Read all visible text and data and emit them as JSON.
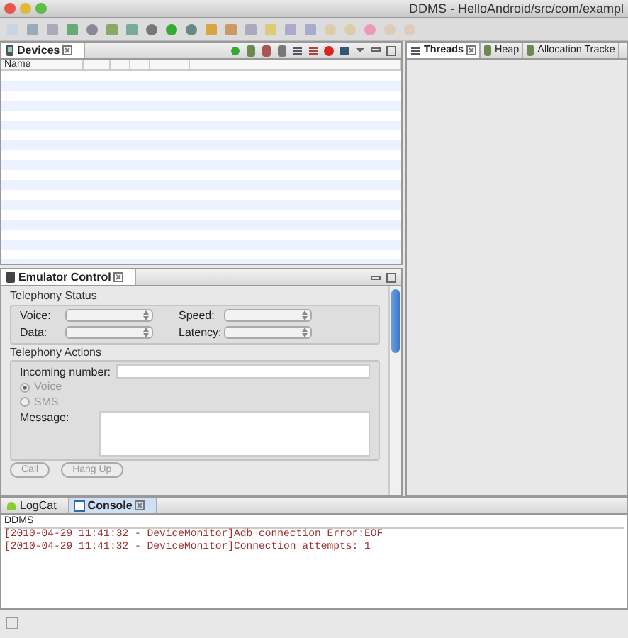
{
  "window": {
    "title": "DDMS - HelloAndroid/src/com/exampl"
  },
  "devices_view": {
    "tab": {
      "label": "Devices",
      "selected": true
    },
    "table": {
      "columns": [
        "Name"
      ]
    }
  },
  "right_tabs": [
    {
      "label": "Threads",
      "selected": true,
      "kind": "threads"
    },
    {
      "label": "Heap",
      "selected": false,
      "kind": "heap"
    },
    {
      "label": "Allocation Tracke",
      "selected": false,
      "kind": "heap"
    }
  ],
  "emulator_control": {
    "tab": {
      "label": "Emulator Control",
      "selected": true
    },
    "telephony_status": {
      "title": "Telephony Status",
      "fields": [
        {
          "label": "Voice:"
        },
        {
          "label": "Speed:"
        },
        {
          "label": "Data:"
        },
        {
          "label": "Latency:"
        }
      ]
    },
    "telephony_actions": {
      "title": "Telephony Actions",
      "incoming_number": {
        "label": "Incoming number:"
      },
      "options": [
        {
          "label": "Voice",
          "selected": true,
          "disabled": true
        },
        {
          "label": "SMS",
          "selected": false,
          "disabled": true
        }
      ],
      "message": {
        "label": "Message:"
      },
      "buttons": [
        {
          "label": "Call",
          "disabled": true
        },
        {
          "label": "Hang Up",
          "disabled": true
        }
      ]
    }
  },
  "console_tabs": [
    {
      "label": "LogCat",
      "selected": false,
      "kind": "logcat"
    },
    {
      "label": "Console",
      "selected": true,
      "kind": "console"
    }
  ],
  "console": {
    "title": "DDMS",
    "lines": [
      "[2010-04-29 11:41:32 - DeviceMonitor]Adb connection Error:EOF",
      "[2010-04-29 11:41:32 - DeviceMonitor]Connection attempts: 1"
    ]
  }
}
